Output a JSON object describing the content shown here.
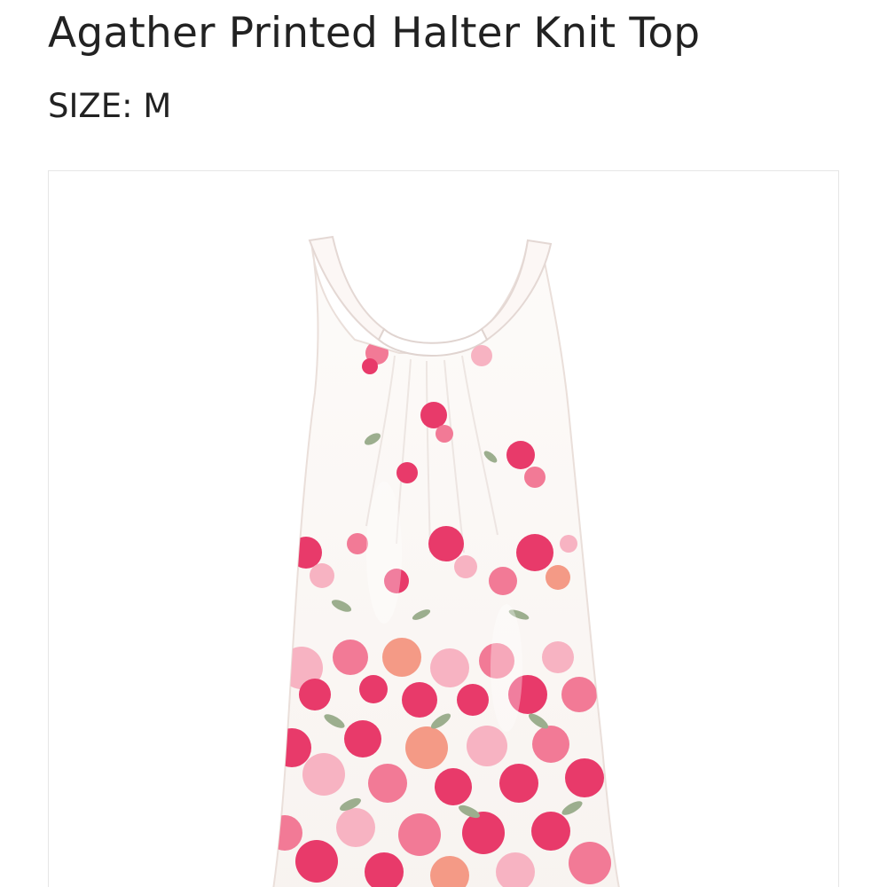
{
  "product": {
    "title": "Agather Printed Halter Knit Top",
    "size_label": "SIZE:",
    "size_value": "M"
  },
  "image": {
    "subject": "white halter knit top with pink floral print",
    "colors": {
      "fabric": "#fbf8f5",
      "shadow": "#ece6e2",
      "pink_deep": "#e83a6a",
      "pink_mid": "#f27a96",
      "pink_light": "#f7b3c2",
      "coral": "#f49a86",
      "leaf": "#9cae8e"
    }
  }
}
